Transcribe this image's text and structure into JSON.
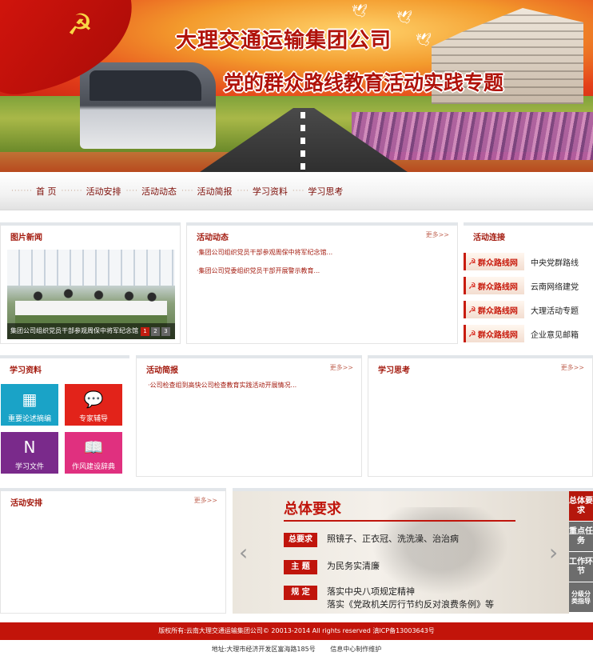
{
  "banner": {
    "company": "大理交通运输集团公司",
    "subtitle": "党的群众路线教育活动实践专题"
  },
  "nav": {
    "items": [
      {
        "label": "首  页"
      },
      {
        "label": "活动安排"
      },
      {
        "label": "活动动态"
      },
      {
        "label": "活动简报"
      },
      {
        "label": "学习资料"
      },
      {
        "label": "学习思考"
      }
    ]
  },
  "photo_news": {
    "title": "图片新闻",
    "caption": "集团公司组织党员干部参观周保中将军纪念馆",
    "pager": [
      "1",
      "2",
      "3"
    ]
  },
  "activity_news": {
    "title": "活动动态",
    "more": "更多>>",
    "items": [
      "·集团公司组织党员干部参观周保中将军纪念馆...",
      "·集团公司党委组织党员干部开展警示教育..."
    ]
  },
  "activity_links": {
    "title": "活动连接",
    "badge_text": "群众路线网",
    "items": [
      {
        "label": "中央党群路线"
      },
      {
        "label": "云南网络建党"
      },
      {
        "label": "大理活动专题"
      },
      {
        "label": "企业意见邮箱"
      }
    ]
  },
  "study_materials": {
    "title": "学习资料",
    "tiles": [
      {
        "label": "重要论述摘编",
        "icon": "map-book-icon",
        "color": "#1aa3c7"
      },
      {
        "label": "专家辅导",
        "icon": "chat-bubble-icon",
        "color": "#e2231a"
      },
      {
        "label": "学习文件",
        "icon": "onenote-icon",
        "color": "#7a2a8b"
      },
      {
        "label": "作风建设辞典",
        "icon": "bookmark-icon",
        "color": "#e0307f"
      }
    ]
  },
  "briefing": {
    "title": "活动简报",
    "more": "更多>>",
    "items": [
      "·公司检查组到高快公司检查教育实践活动开展情况..."
    ]
  },
  "thinking": {
    "title": "学习思考",
    "more": "更多>>"
  },
  "schedule": {
    "title": "活动安排",
    "more": "更多>>"
  },
  "carousel": {
    "title": "总体要求",
    "rows": [
      {
        "tag": "总要求",
        "text": [
          "照镜子、正衣冠、洗洗澡、治治病"
        ]
      },
      {
        "tag": "主  题",
        "text": [
          "为民务实清廉"
        ]
      },
      {
        "tag": "规  定",
        "text": [
          "落实中央八项规定精神",
          "落实《党政机关厉行节约反对浪费条例》等"
        ]
      }
    ],
    "side_tabs": [
      {
        "label": "总体要求"
      },
      {
        "label": "重点任务"
      },
      {
        "label": "工作环节"
      },
      {
        "label": "分级分类指导"
      }
    ],
    "prev": "‹",
    "next": "›"
  },
  "footer": {
    "copyright": "版权所有:云南大理交通运输集团公司© 20013-2014 All rights reserved    滇ICP备13003643号",
    "address": "地址:大理市经济开发区富海路185号",
    "maker": "信息中心制作维护"
  },
  "colors": {
    "brand_red": "#c2140a",
    "title_red": "#a31a0e"
  }
}
